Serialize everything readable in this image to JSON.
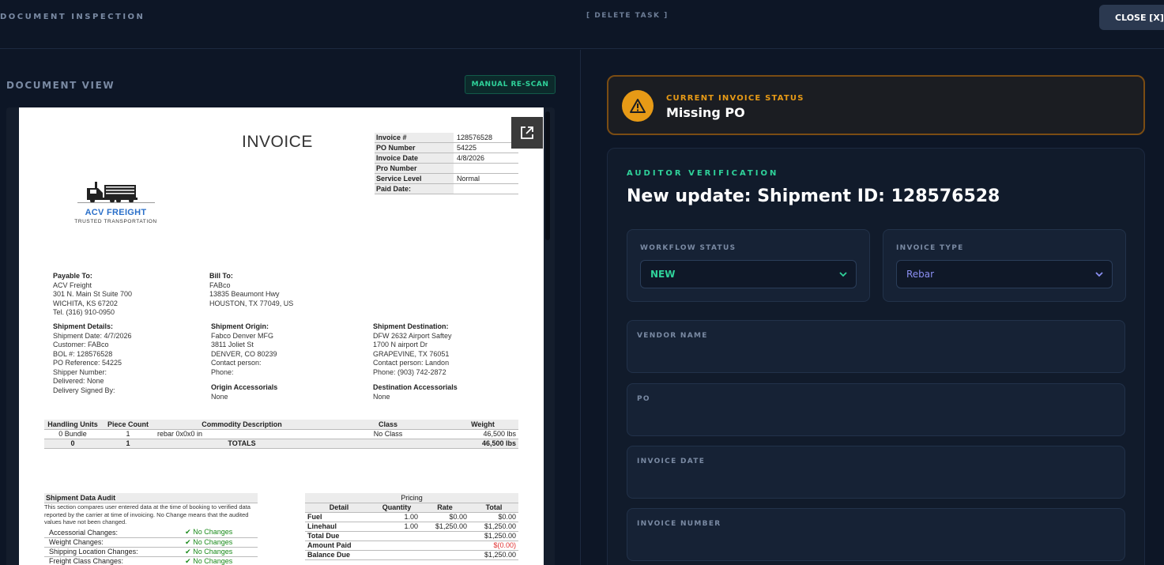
{
  "header": {
    "title": "DOCUMENT INSPECTION",
    "delete_label": "[ DELETE TASK ]",
    "close_label": "CLOSE [X]"
  },
  "left": {
    "section_label": "DOCUMENT VIEW",
    "rescan_label": "MANUAL RE-SCAN"
  },
  "document": {
    "title": "INVOICE",
    "meta": [
      {
        "k": "Invoice #",
        "v": "128576528"
      },
      {
        "k": "PO Number",
        "v": "54225"
      },
      {
        "k": "Invoice Date",
        "v": "4/8/2026"
      },
      {
        "k": "Pro Number",
        "v": ""
      },
      {
        "k": "Service Level",
        "v": "Normal"
      },
      {
        "k": "Paid Date:",
        "v": ""
      }
    ],
    "logo": {
      "name": "ACV FREIGHT",
      "tagline": "TRUSTED TRANSPORTATION"
    },
    "payable": {
      "title": "Payable To:",
      "lines": [
        "ACV Freight",
        "301 N. Main St Suite 700",
        "WICHITA, KS 67202",
        "Tel. (316) 910-0950"
      ]
    },
    "bill": {
      "title": "Bill To:",
      "lines": [
        "FABco",
        "13835 Beaumont Hwy",
        "HOUSTON, TX 77049, US"
      ]
    },
    "shipment": {
      "title": "Shipment Details:",
      "lines": [
        "Shipment Date: 4/7/2026",
        "Customer: FABco",
        "BOL #: 128576528",
        "PO Reference: 54225",
        "Shipper Number:",
        "Delivered: None",
        "Delivery Signed By:"
      ]
    },
    "origin": {
      "title": "Shipment Origin:",
      "lines": [
        "Fabco Denver MFG",
        "3811 Joliet St",
        "DENVER, CO 80239",
        "Contact person:",
        "Phone:"
      ]
    },
    "destination": {
      "title": "Shipment Destination:",
      "lines": [
        "DFW 2632 Airport Saftey",
        "1700 N airport Dr",
        "GRAPEVINE, TX 76051",
        "Contact person: Landon",
        "Phone: (903) 742-2872"
      ]
    },
    "origin_acc": {
      "title": "Origin Accessorials",
      "value": "None"
    },
    "dest_acc": {
      "title": "Destination Accessorials",
      "value": "None"
    },
    "goods": {
      "headers": [
        "Handling Units",
        "Piece Count",
        "Commodity Description",
        "Class",
        "Weight"
      ],
      "row": [
        "0 Bundle",
        "1",
        "rebar 0x0x0 in",
        "No Class",
        "46,500 lbs"
      ],
      "totals": [
        "0",
        "1",
        "TOTALS",
        "",
        "46,500 lbs"
      ]
    },
    "audit": {
      "title": "Shipment Data Audit",
      "desc": "This section compares user entered data at the time of booking to verified data reported by the carrier at time of invoicing. No Change means that the audited values have not been changed.",
      "rows": [
        {
          "k": "Accessorial Changes:",
          "v": "✔ No Changes"
        },
        {
          "k": "Weight Changes:",
          "v": "✔ No Changes"
        },
        {
          "k": "Shipping Location Changes:",
          "v": "✔ No Changes"
        },
        {
          "k": "Freight Class Changes:",
          "v": "✔ No Changes"
        }
      ]
    },
    "pricing": {
      "title": "Pricing",
      "headers": [
        "Detail",
        "Quantity",
        "Rate",
        "Total"
      ],
      "rows": [
        {
          "d": "Fuel",
          "q": "1.00",
          "r": "$0.00",
          "t": "$0.00"
        },
        {
          "d": "Linehaul",
          "q": "1.00",
          "r": "$1,250.00",
          "t": "$1,250.00"
        },
        {
          "d": "Total Due",
          "q": "",
          "r": "",
          "t": "$1,250.00"
        },
        {
          "d": "Amount Paid",
          "q": "",
          "r": "",
          "t": "$(0.00)"
        },
        {
          "d": "Balance Due",
          "q": "",
          "r": "",
          "t": "$1,250.00"
        }
      ]
    }
  },
  "status": {
    "label": "CURRENT INVOICE STATUS",
    "value": "Missing PO"
  },
  "auditor": {
    "label": "AUDITOR VERIFICATION",
    "title": "New update: Shipment ID: 128576528",
    "workflow": {
      "label": "WORKFLOW STATUS",
      "value": "NEW"
    },
    "invoice_type": {
      "label": "INVOICE TYPE",
      "value": "Rebar"
    },
    "fields": [
      {
        "label": "VENDOR NAME"
      },
      {
        "label": "PO"
      },
      {
        "label": "INVOICE DATE"
      },
      {
        "label": "INVOICE NUMBER"
      }
    ]
  },
  "colors": {
    "accent_green": "#2fd29a",
    "warning": "#e79a16",
    "select_new": "#2fd29a",
    "select_rebar": "#8b8ff2"
  }
}
